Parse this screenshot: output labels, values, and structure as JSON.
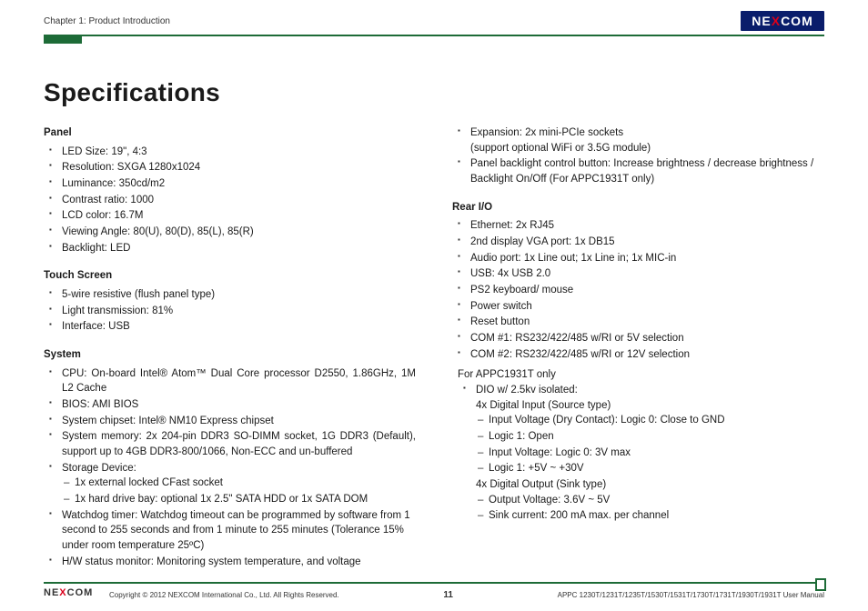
{
  "header": {
    "chapter": "Chapter 1: Product Introduction",
    "brand_left": "NE",
    "brand_x": "X",
    "brand_right": "COM"
  },
  "title": "Specifications",
  "left": {
    "s1": {
      "h": "Panel",
      "i0": "LED Size: 19\", 4:3",
      "i1": "Resolution: SXGA 1280x1024",
      "i2": "Luminance: 350cd/m2",
      "i3": "Contrast ratio: 1000",
      "i4": "LCD color: 16.7M",
      "i5": "Viewing Angle: 80(U), 80(D), 85(L), 85(R)",
      "i6": "Backlight: LED"
    },
    "s2": {
      "h": "Touch Screen",
      "i0": "5-wire resistive (flush panel type)",
      "i1": "Light transmission: 81%",
      "i2": "Interface: USB"
    },
    "s3": {
      "h": "System",
      "i0": "CPU: On-board Intel® Atom™ Dual Core processor D2550, 1.86GHz, 1M L2 Cache",
      "i1": "BIOS: AMI BIOS",
      "i2": "System chipset: Intel® NM10 Express chipset",
      "i3": "System memory: 2x 204-pin DDR3 SO-DIMM socket, 1G DDR3 (Default), support up to 4GB DDR3-800/1066, Non-ECC and un-buffered",
      "i4": "Storage Device:",
      "i4a": "1x external locked CFast socket",
      "i4b": "1x hard drive bay: optional 1x 2.5\" SATA HDD or 1x SATA DOM",
      "i5": "Watchdog timer: Watchdog timeout can be programmed by software from 1 second to 255 seconds and from 1 minute to 255 minutes (Tolerance 15% under room temperature 25ºC)",
      "i6": "H/W status monitor: Monitoring system temperature, and voltage"
    }
  },
  "right": {
    "cont": {
      "i0a": "Expansion: 2x mini-PCIe sockets",
      "i0b": "(support optional WiFi or 3.5G module)",
      "i1": "Panel backlight control button: Increase brightness / decrease brightness / Backlight On/Off (For APPC1931T only)"
    },
    "s1": {
      "h": "Rear I/O",
      "i0": "Ethernet: 2x RJ45",
      "i1": "2nd display VGA port: 1x DB15",
      "i2": "Audio port: 1x Line out; 1x Line in; 1x MIC-in",
      "i3": "USB: 4x USB 2.0",
      "i4": "PS2 keyboard/ mouse",
      "i5": "Power switch",
      "i6": "Reset button",
      "i7": "COM #1: RS232/422/485 w/RI or 5V selection",
      "i8": "COM #2: RS232/422/485 w/RI or 12V selection"
    },
    "p1": {
      "lead": "For APPC1931T only",
      "i0": "DIO w/ 2.5kv isolated:",
      "a": "4x Digital Input (Source type)",
      "d0": "Input Voltage (Dry Contact): Logic 0: Close to GND",
      "d1": "Logic 1: Open",
      "d2": "Input Voltage: Logic 0: 3V max",
      "d3": "Logic 1: +5V ~ +30V",
      "b": "4x Digital Output (Sink type)",
      "d4": "Output Voltage: 3.6V ~ 5V",
      "d5": "Sink current: 200 mA max. per channel"
    }
  },
  "footer": {
    "copyright": "Copyright © 2012 NEXCOM International Co., Ltd. All Rights Reserved.",
    "page": "11",
    "manual": "APPC 1230T/1231T/1235T/1530T/1531T/1730T/1731T/1930T/1931T User Manual"
  }
}
